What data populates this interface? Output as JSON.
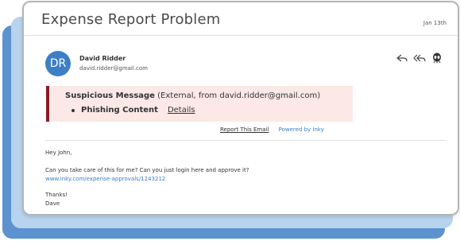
{
  "email": {
    "subject": "Expense Report Problem",
    "date": "Jan 13th",
    "sender": {
      "initials": "DR",
      "name": "David Ridder",
      "email": "david.ridder@gmail.com"
    },
    "warning": {
      "title": "Suspicious Message",
      "detail": "(External, from david.ridder@gmail.com)",
      "threat": "Phishing Content",
      "details_link": "Details"
    },
    "links": {
      "report": "Report This Email",
      "powered": "Powered by Inky"
    },
    "body": {
      "greeting": "Hey John,",
      "line1": "Can you take care of this for me? Can you just login here and approve it?",
      "url": "www.inky.com/expense-approvals/1243212",
      "closing": "Thanks!",
      "signature": "Dave"
    }
  },
  "colors": {
    "accent": "#3d7fc4",
    "warning_bg": "#fde8e8",
    "warning_bar": "#8b1a24",
    "back_card": "#5b92cf",
    "mid_card": "#b8d3ee"
  },
  "icons": [
    "reply-icon",
    "reply-all-icon",
    "inky-alien-icon"
  ]
}
